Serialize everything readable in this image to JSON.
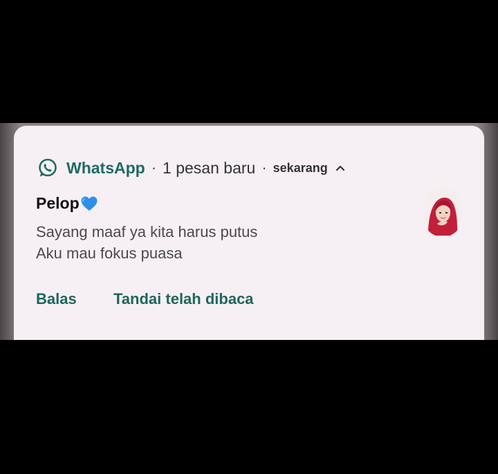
{
  "notification": {
    "app_name": "WhatsApp",
    "separator": "·",
    "new_messages": "1 pesan baru",
    "timestamp": "sekarang",
    "sender": "Pelop",
    "message_lines": [
      "Sayang maaf ya kita harus putus",
      "Aku mau fokus puasa"
    ],
    "actions": {
      "reply": "Balas",
      "mark_read": "Tandai telah dibaca"
    }
  },
  "icons": {
    "app": "whatsapp-icon",
    "collapse": "chevron-up-icon",
    "sender_emoji": "blue-heart-icon",
    "avatar": "contact-avatar"
  },
  "colors": {
    "background": "#000000",
    "card": "#f6f0f5",
    "accent": "#1f6b62",
    "heart": "#2f8fe8"
  }
}
